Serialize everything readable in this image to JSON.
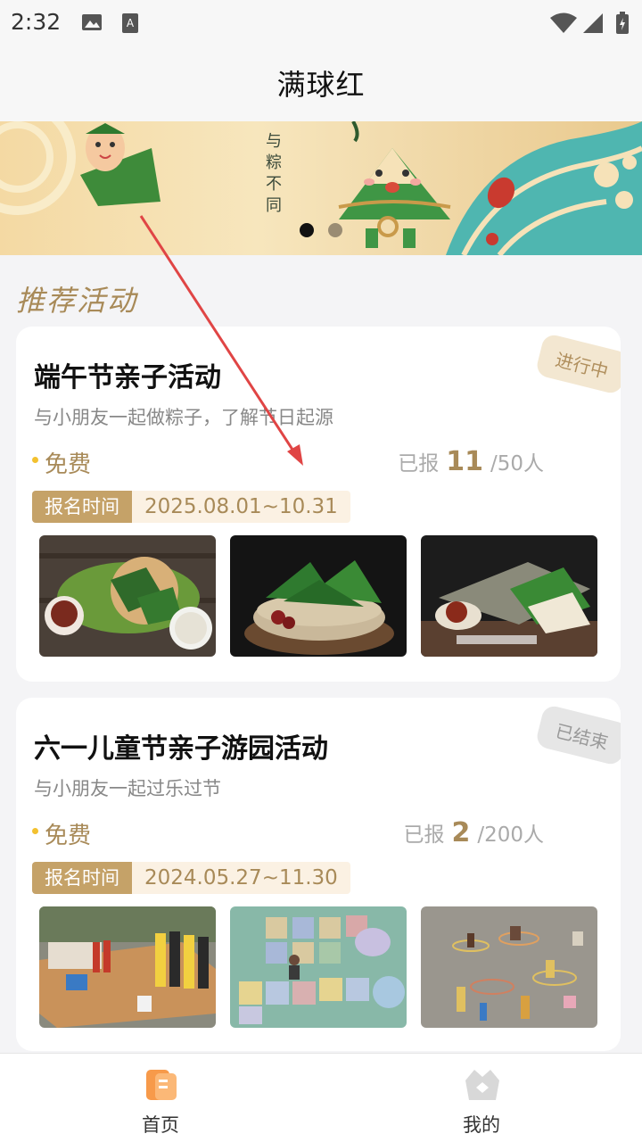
{
  "status_bar": {
    "time": "2:32"
  },
  "app_bar": {
    "title": "满球红"
  },
  "banner": {
    "text": "与粽不同"
  },
  "section": {
    "title": "推荐活动"
  },
  "activities": [
    {
      "title": "端午节亲子活动",
      "subtitle": "与小朋友一起做粽子，了解节日起源",
      "price": "免费",
      "signup_prefix": "已报",
      "signup_count": "11",
      "signup_total": "/50人",
      "date_label": "报名时间",
      "date_range": "2025.08.01~10.31",
      "status": "进行中"
    },
    {
      "title": "六一儿童节亲子游园活动",
      "subtitle": "与小朋友一起过乐过节",
      "price": "免费",
      "signup_prefix": "已报",
      "signup_count": "2",
      "signup_total": "/200人",
      "date_label": "报名时间",
      "date_range": "2024.05.27~11.30",
      "status": "已结束"
    }
  ],
  "bottom_nav": {
    "home": "首页",
    "mine": "我的"
  },
  "colors": {
    "accent": "#a88a58",
    "badge_bg": "#c5a268",
    "price_dot": "#f3c12f"
  }
}
